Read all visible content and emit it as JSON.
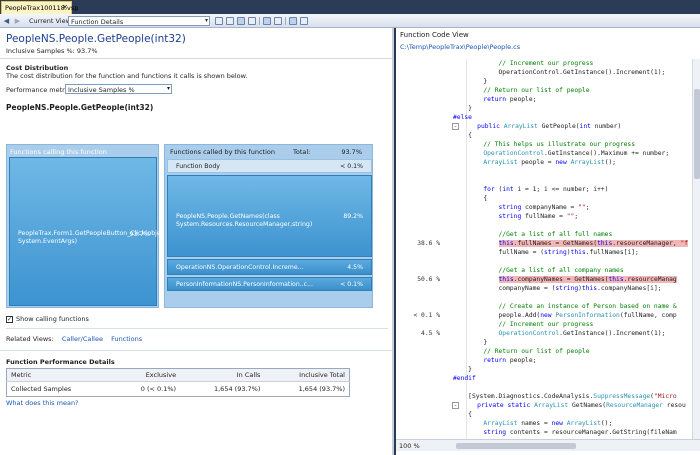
{
  "document_tab": {
    "title": "PeopleTrax100118.vsp",
    "close": "×"
  },
  "toolbar": {
    "back": "◀",
    "forward": "▶",
    "current_view_label": "Current View:",
    "current_view_value": "Function Details",
    "dropdown_arrow": "▾"
  },
  "summary": {
    "function_name": "PeopleNS.People.GetPeople(int32)",
    "inclusive_samples": "Inclusive Samples %: 93.7%"
  },
  "cost_distribution": {
    "heading": "Cost Distribution",
    "description": "The cost distribution for the function and functions it calls is shown below.",
    "metric_label": "Performance metric:",
    "metric_value": "Inclusive Samples %",
    "function_title": "PeopleNS.People.GetPeople(int32)",
    "callers_header": "Functions calling this function",
    "caller": {
      "name": "PeopleTrax.Form1.GetPeopleButton_Click(object,class System.EventArgs)",
      "pct": "93.7%"
    },
    "callees_header": "Functions called by this function",
    "total_label": "Total:",
    "total_pct": "93.7%",
    "callees": [
      {
        "name": "Function Body",
        "pct": "< 0.1%"
      },
      {
        "name": "PeopleNS.People.GetNames(class System.Resources.ResourceManager,string)",
        "pct": "89.2%"
      },
      {
        "name": "OperationNS.OperationControl.Increme...",
        "pct": "4.5%"
      },
      {
        "name": "PersonInformationNS.PersonInformation..c...",
        "pct": "< 0.1%"
      }
    ],
    "show_calling_label": "Show calling functions",
    "show_calling_checked": "✓"
  },
  "related_views": {
    "label": "Related Views:",
    "links": [
      "Caller/Callee",
      "Functions"
    ]
  },
  "performance_details": {
    "heading": "Function Performance Details",
    "columns": [
      "Metric",
      "Exclusive",
      "In Calls",
      "Inclusive Total"
    ],
    "rows": [
      [
        "Collected Samples",
        "0 (< 0.1%)",
        "1,654 (93.7%)",
        "1,654 (93.7%)"
      ]
    ],
    "help_link": "What does this mean?"
  },
  "code_view": {
    "title": "Function Code View",
    "path": "C:\\Temp\\PeopleTrax\\People\\People.cs",
    "zoom": "100 %",
    "lines": [
      {
        "pct": "",
        "fold": "",
        "html": "            <span class=\"cm\">// Increment our progress</span>"
      },
      {
        "pct": "",
        "fold": "",
        "html": "            OperationControl.GetInstance().Increment(1);"
      },
      {
        "pct": "",
        "fold": "",
        "html": "        }"
      },
      {
        "pct": "",
        "fold": "",
        "html": "        <span class=\"cm\">// Return our list of people</span>"
      },
      {
        "pct": "",
        "fold": "",
        "html": "        <span class=\"kw\">return</span> people;"
      },
      {
        "pct": "",
        "fold": "",
        "html": "    }"
      },
      {
        "pct": "",
        "fold": "",
        "html": "<span class=\"pp\">#else</span>"
      },
      {
        "pct": "",
        "fold": "-",
        "html": "    <span class=\"kw\">public</span> <span class=\"ty\">ArrayList</span> GetPeople(<span class=\"kw\">int</span> number)"
      },
      {
        "pct": "",
        "fold": "",
        "html": "    {"
      },
      {
        "pct": "",
        "fold": "",
        "html": "        <span class=\"cm\">// This helps us illustrate our progress</span>"
      },
      {
        "pct": "",
        "fold": "",
        "html": "        <span class=\"ty\">OperationControl</span>.GetInstance().Maximum += number;"
      },
      {
        "pct": "",
        "fold": "",
        "html": "        <span class=\"ty\">ArrayList</span> people = <span class=\"kw\">new</span> <span class=\"ty\">ArrayList</span>();"
      },
      {
        "pct": "",
        "fold": "",
        "html": ""
      },
      {
        "pct": "",
        "fold": "",
        "html": ""
      },
      {
        "pct": "",
        "fold": "",
        "html": "        <span class=\"kw\">for</span> (<span class=\"kw\">int</span> i = 1; i &lt;= number; i++)"
      },
      {
        "pct": "",
        "fold": "",
        "html": "        {"
      },
      {
        "pct": "",
        "fold": "",
        "html": "            <span class=\"kw\">string</span> companyName = <span class=\"st\">\"\"</span>;"
      },
      {
        "pct": "",
        "fold": "",
        "html": "            <span class=\"kw\">string</span> fullName = <span class=\"st\">\"\"</span>;"
      },
      {
        "pct": "",
        "fold": "",
        "html": ""
      },
      {
        "pct": "",
        "fold": "",
        "html": "            <span class=\"cm\">//Get a list of all full names</span>"
      },
      {
        "pct": "38.6 %",
        "fold": "",
        "html": "            <span class=\"hl\"><span class=\"kw\">this</span>.fullNames = GetNames(<span class=\"kw\">this</span>.resourceManager, <span class=\"st\">\"f</span></span>"
      },
      {
        "pct": "",
        "fold": "",
        "html": "            fullName = (<span class=\"kw\">string</span>)<span class=\"kw\">this</span>.fullNames[i];"
      },
      {
        "pct": "",
        "fold": "",
        "html": ""
      },
      {
        "pct": "",
        "fold": "",
        "html": "            <span class=\"cm\">//Get a list of all company names</span>"
      },
      {
        "pct": "50.6 %",
        "fold": "",
        "html": "            <span class=\"hl\"><span class=\"kw\">this</span>.companyNames = GetNames(<span class=\"kw\">this</span>.resourceManag</span>"
      },
      {
        "pct": "",
        "fold": "",
        "html": "            companyName = (<span class=\"kw\">string</span>)<span class=\"kw\">this</span>.companyNames[i];"
      },
      {
        "pct": "",
        "fold": "",
        "html": ""
      },
      {
        "pct": "",
        "fold": "",
        "html": "            <span class=\"cm\">// Create an instance of Person based on name &amp;</span>"
      },
      {
        "pct": "< 0.1 %",
        "fold": "",
        "html": "            people.Add(<span class=\"kw\">new</span> <span class=\"ty\">PersonInformation</span>(fullName, comp"
      },
      {
        "pct": "",
        "fold": "",
        "html": "            <span class=\"cm\">// Increment our progress</span>"
      },
      {
        "pct": "4.5 %",
        "fold": "",
        "html": "            <span class=\"ty\">OperationControl</span>.GetInstance().Increment(1);"
      },
      {
        "pct": "",
        "fold": "",
        "html": "        }"
      },
      {
        "pct": "",
        "fold": "",
        "html": "        <span class=\"cm\">// Return our list of people</span>"
      },
      {
        "pct": "",
        "fold": "",
        "html": "        <span class=\"kw\">return</span> people;"
      },
      {
        "pct": "",
        "fold": "",
        "html": "    }"
      },
      {
        "pct": "",
        "fold": "",
        "html": "<span class=\"pp\">#endif</span>"
      },
      {
        "pct": "",
        "fold": "",
        "html": ""
      },
      {
        "pct": "",
        "fold": "",
        "html": "    [System.Diagnostics.CodeAnalysis.<span class=\"ty\">SuppressMessage</span>(<span class=\"st\">\"Micro</span>"
      },
      {
        "pct": "",
        "fold": "-",
        "html": "    <span class=\"kw\">private</span> <span class=\"kw\">static</span> <span class=\"ty\">ArrayList</span> GetNames(<span class=\"ty\">ResourceManager</span> resou"
      },
      {
        "pct": "",
        "fold": "",
        "html": "    {"
      },
      {
        "pct": "",
        "fold": "",
        "html": "        <span class=\"ty\">ArrayList</span> names = <span class=\"kw\">new</span> <span class=\"ty\">ArrayList</span>();"
      },
      {
        "pct": "",
        "fold": "",
        "html": "        <span class=\"kw\">string</span> contents = resourceManager.GetString(fileNam"
      }
    ]
  },
  "colors": {
    "accent_bar": "#3c93cf",
    "highlight": "#f1b6b6",
    "link": "#1a55b8"
  }
}
